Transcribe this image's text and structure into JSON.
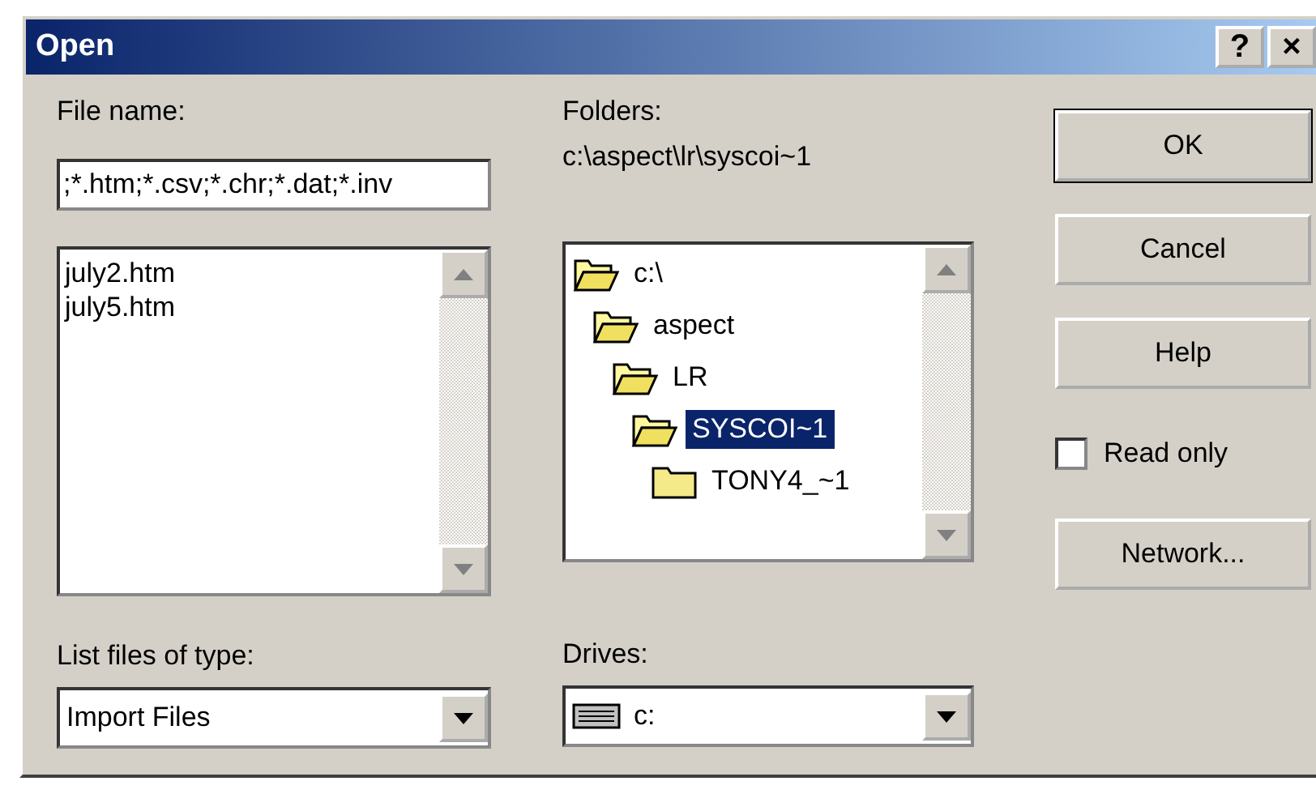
{
  "window": {
    "title": "Open",
    "title_buttons": [
      "?",
      "×"
    ]
  },
  "file_name": {
    "label": "File name:",
    "value": ";*.htm;*.csv;*.chr;*.dat;*.inv"
  },
  "files": [
    "july2.htm",
    "july5.htm"
  ],
  "file_type": {
    "label": "List files of type:",
    "value": "Import Files"
  },
  "folders": {
    "label": "Folders:",
    "path": "c:\\aspect\\lr\\syscoi~1",
    "tree": [
      {
        "name": "c:\\",
        "expanded": true,
        "selected": false,
        "children": [
          {
            "name": "aspect",
            "expanded": true,
            "selected": false,
            "children": [
              {
                "name": "LR",
                "expanded": true,
                "selected": false,
                "children": [
                  {
                    "name": "SYSCOI~1",
                    "expanded": true,
                    "selected": true,
                    "children": [
                      {
                        "name": "TONY4_~1",
                        "expanded": false,
                        "selected": false
                      }
                    ]
                  }
                ]
              }
            ]
          }
        ]
      }
    ]
  },
  "drives": {
    "label": "Drives:",
    "value": "c:"
  },
  "buttons": [
    {
      "label": "OK",
      "default": true
    },
    {
      "label": "Cancel",
      "default": false
    },
    {
      "label": "Help",
      "default": false
    }
  ],
  "read_only": {
    "label": "Read only",
    "checked": false
  },
  "network_button": {
    "label": "Network..."
  }
}
